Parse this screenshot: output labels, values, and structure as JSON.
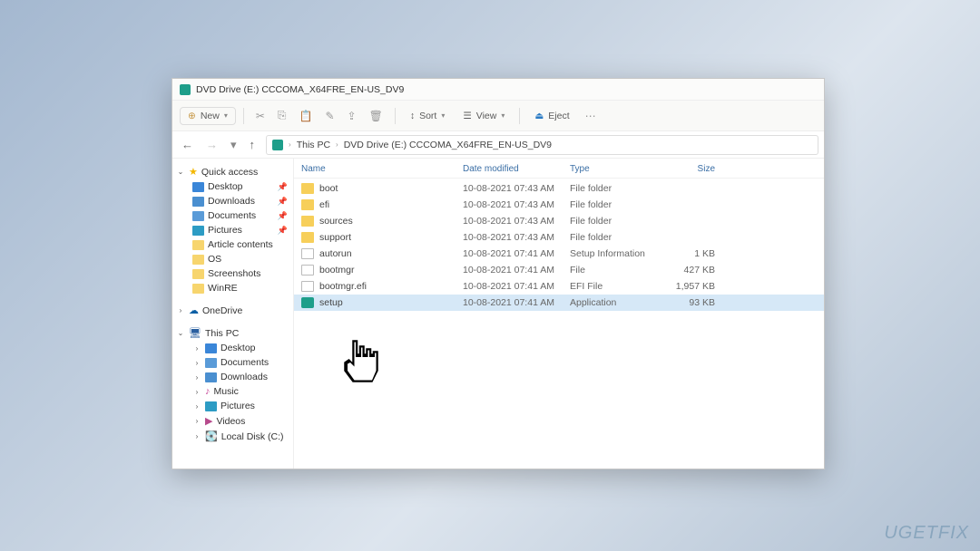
{
  "window": {
    "title": "DVD Drive (E:) CCCOMA_X64FRE_EN-US_DV9"
  },
  "toolbar": {
    "new": "New",
    "sort": "Sort",
    "view": "View",
    "eject": "Eject"
  },
  "breadcrumb": {
    "seg1": "This PC",
    "seg2": "DVD Drive (E:) CCCOMA_X64FRE_EN-US_DV9"
  },
  "sidebar": {
    "quick_access": "Quick access",
    "desktop": "Desktop",
    "downloads": "Downloads",
    "documents": "Documents",
    "pictures": "Pictures",
    "article": "Article contents",
    "os": "OS",
    "screenshots": "Screenshots",
    "winre": "WinRE",
    "onedrive": "OneDrive",
    "thispc": "This PC",
    "music": "Music",
    "videos": "Videos",
    "localdisk": "Local Disk (C:)"
  },
  "columns": {
    "name": "Name",
    "date": "Date modified",
    "type": "Type",
    "size": "Size"
  },
  "files": [
    {
      "name": "boot",
      "date": "10-08-2021 07:43 AM",
      "type": "File folder",
      "size": "",
      "icon": "folder"
    },
    {
      "name": "efi",
      "date": "10-08-2021 07:43 AM",
      "type": "File folder",
      "size": "",
      "icon": "folder"
    },
    {
      "name": "sources",
      "date": "10-08-2021 07:43 AM",
      "type": "File folder",
      "size": "",
      "icon": "folder"
    },
    {
      "name": "support",
      "date": "10-08-2021 07:43 AM",
      "type": "File folder",
      "size": "",
      "icon": "folder"
    },
    {
      "name": "autorun",
      "date": "10-08-2021 07:41 AM",
      "type": "Setup Information",
      "size": "1 KB",
      "icon": "file"
    },
    {
      "name": "bootmgr",
      "date": "10-08-2021 07:41 AM",
      "type": "File",
      "size": "427 KB",
      "icon": "file"
    },
    {
      "name": "bootmgr.efi",
      "date": "10-08-2021 07:41 AM",
      "type": "EFI File",
      "size": "1,957 KB",
      "icon": "file"
    },
    {
      "name": "setup",
      "date": "10-08-2021 07:41 AM",
      "type": "Application",
      "size": "93 KB",
      "icon": "app",
      "selected": true
    }
  ],
  "watermark": "UGETFIX"
}
